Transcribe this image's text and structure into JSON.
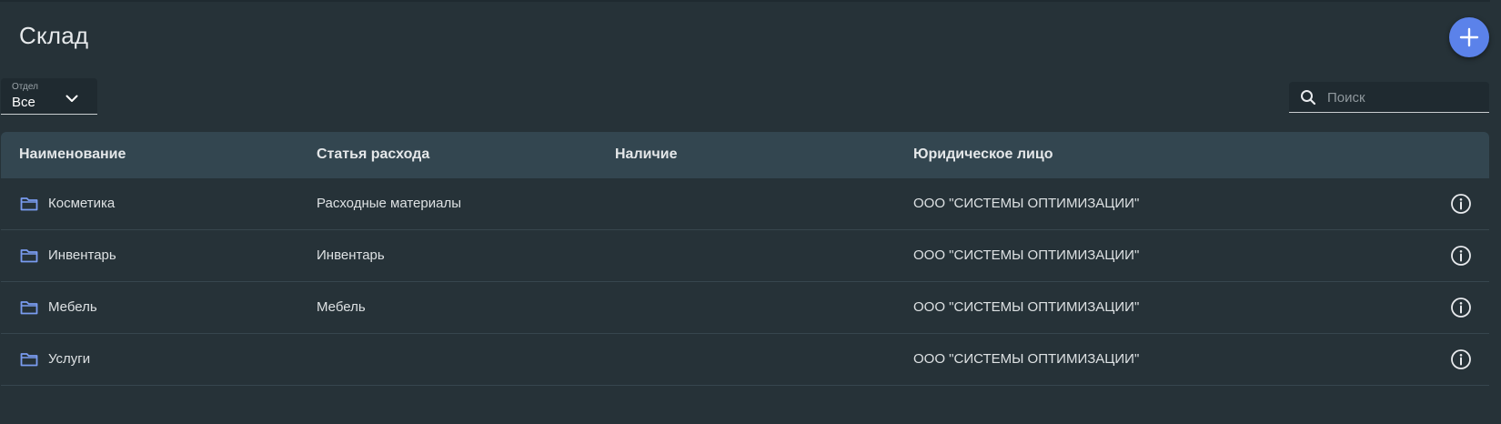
{
  "page": {
    "title": "Склад"
  },
  "toolbar": {
    "add_icon": "plus-icon"
  },
  "filters": {
    "department": {
      "label": "Отдел",
      "value": "Все"
    },
    "search": {
      "placeholder": "Поиск",
      "value": ""
    }
  },
  "table": {
    "columns": [
      "Наименование",
      "Статья расхода",
      "Наличие",
      "Юридическое лицо"
    ],
    "rows": [
      {
        "name": "Косметика",
        "expense": "Расходные материалы",
        "stock": "",
        "legal": "ООО \"СИСТЕМЫ ОПТИМИЗАЦИИ\""
      },
      {
        "name": "Инвентарь",
        "expense": "Инвентарь",
        "stock": "",
        "legal": "ООО \"СИСТЕМЫ ОПТИМИЗАЦИИ\""
      },
      {
        "name": "Мебель",
        "expense": "Мебель",
        "stock": "",
        "legal": "ООО \"СИСТЕМЫ ОПТИМИЗАЦИИ\""
      },
      {
        "name": "Услуги",
        "expense": "",
        "stock": "",
        "legal": "ООО \"СИСТЕМЫ ОПТИМИЗАЦИИ\""
      }
    ]
  },
  "colors": {
    "background": "#263238",
    "accent": "#5b82ea",
    "header_row": "#334650",
    "folder_icon": "#7a9cf0"
  }
}
